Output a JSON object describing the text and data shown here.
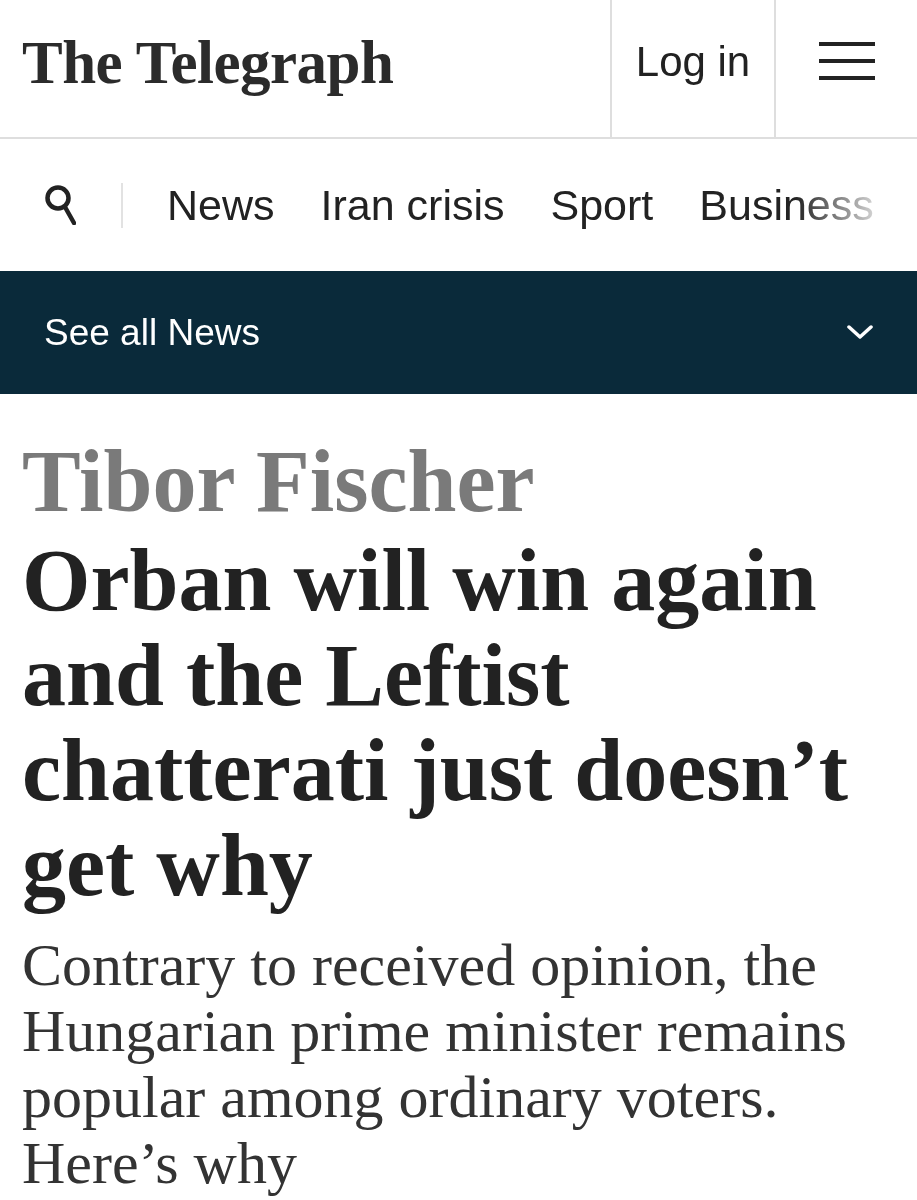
{
  "header": {
    "logo": "The Telegraph",
    "login": "Log in"
  },
  "nav": {
    "items": [
      {
        "label": "News"
      },
      {
        "label": "Iran crisis"
      },
      {
        "label": "Sport"
      },
      {
        "label": "Business"
      }
    ]
  },
  "section_bar": {
    "label": "See all News",
    "expanded": false
  },
  "article": {
    "kicker": "Tibor Fischer",
    "headline": "Orban will win again and the Leftist chatterati just doesn’t get why",
    "standfirst": "Contrary to received opinion, the Hungarian prime minister remains popular among ordinary voters. Here’s why"
  }
}
